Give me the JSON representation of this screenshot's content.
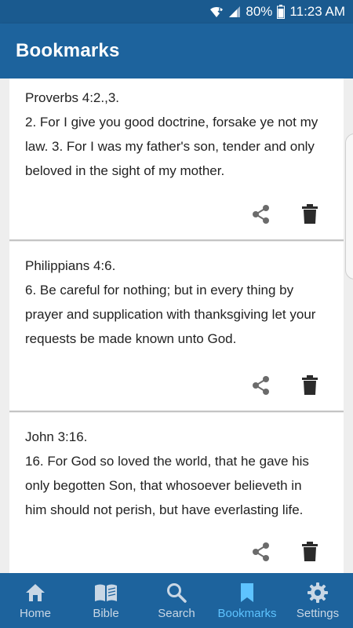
{
  "status_bar": {
    "battery": "80%",
    "time": "11:23 AM"
  },
  "app_bar": {
    "title": "Bookmarks"
  },
  "bookmarks": [
    {
      "reference": "Proverbs 4:2.,3.",
      "lines": [
        "2. For I give you good doctrine, forsake ye not my",
        "law. 3. For I was my father's son, tender and only",
        "beloved in the sight of my mother."
      ]
    },
    {
      "reference": "Philippians 4:6.",
      "lines": [
        "6. Be careful for nothing; but in every thing by",
        "prayer and supplication with thanksgiving let your",
        "requests be made known unto God."
      ]
    },
    {
      "reference": "John 3:16.",
      "lines": [
        "16. For God so loved the world, that he gave his",
        "only begotten Son, that whosoever believeth in",
        "him should not perish, but have everlasting life."
      ]
    }
  ],
  "nav": {
    "items": [
      {
        "label": "Home",
        "icon": "home-icon"
      },
      {
        "label": "Bible",
        "icon": "book-icon"
      },
      {
        "label": "Search",
        "icon": "search-icon"
      },
      {
        "label": "Bookmarks",
        "icon": "bookmark-icon",
        "active": true
      },
      {
        "label": "Settings",
        "icon": "gear-icon"
      }
    ]
  },
  "colors": {
    "primary": "#1d639d",
    "status": "#1a5a8f",
    "active_tab": "#5ec3ff",
    "inactive_tab": "#c9d7e5"
  }
}
